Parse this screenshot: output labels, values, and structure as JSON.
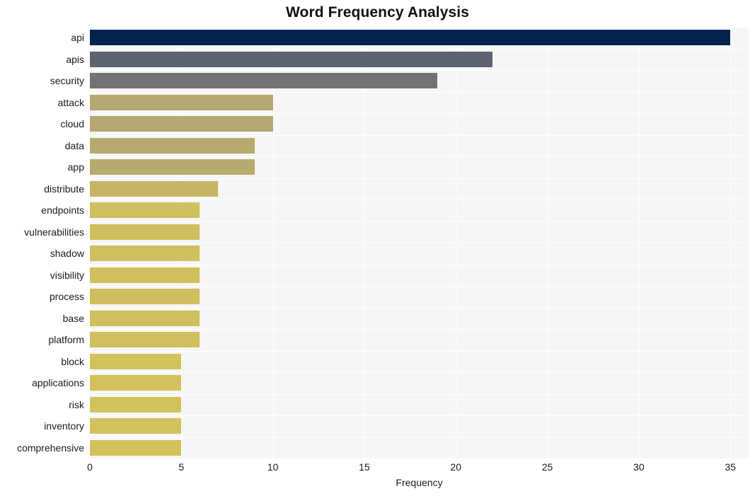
{
  "chart_data": {
    "type": "bar",
    "orientation": "horizontal",
    "title": "Word Frequency Analysis",
    "xlabel": "Frequency",
    "ylabel": "",
    "categories": [
      "api",
      "apis",
      "security",
      "attack",
      "cloud",
      "data",
      "app",
      "distribute",
      "endpoints",
      "vulnerabilities",
      "shadow",
      "visibility",
      "process",
      "base",
      "platform",
      "block",
      "applications",
      "risk",
      "inventory",
      "comprehensive"
    ],
    "values": [
      35,
      22,
      19,
      10,
      10,
      9,
      9,
      7,
      6,
      6,
      6,
      6,
      6,
      6,
      6,
      5,
      5,
      5,
      5,
      5
    ],
    "bar_colors": [
      "#04244d",
      "#5e6371",
      "#707274",
      "#b3a871",
      "#b3a871",
      "#b6aa6e",
      "#b6aa6e",
      "#c4b565",
      "#cfbf5e",
      "#cfbf5e",
      "#cfbf5e",
      "#cfbf5e",
      "#cfbf5e",
      "#cfbf5e",
      "#cfbf5e",
      "#d3c25c",
      "#d3c25c",
      "#d3c25c",
      "#d3c25c",
      "#d3c25c"
    ],
    "xlim": [
      0,
      36
    ],
    "xticks": [
      0,
      5,
      10,
      15,
      20,
      25,
      30,
      35
    ],
    "xtick_labels": [
      "0",
      "5",
      "10",
      "15",
      "20",
      "25",
      "30",
      "35"
    ],
    "grid": true,
    "grid_color": "#ffffff",
    "plot_background": "#f6f6f7",
    "figure_background": "#ffffff",
    "legend": null
  }
}
